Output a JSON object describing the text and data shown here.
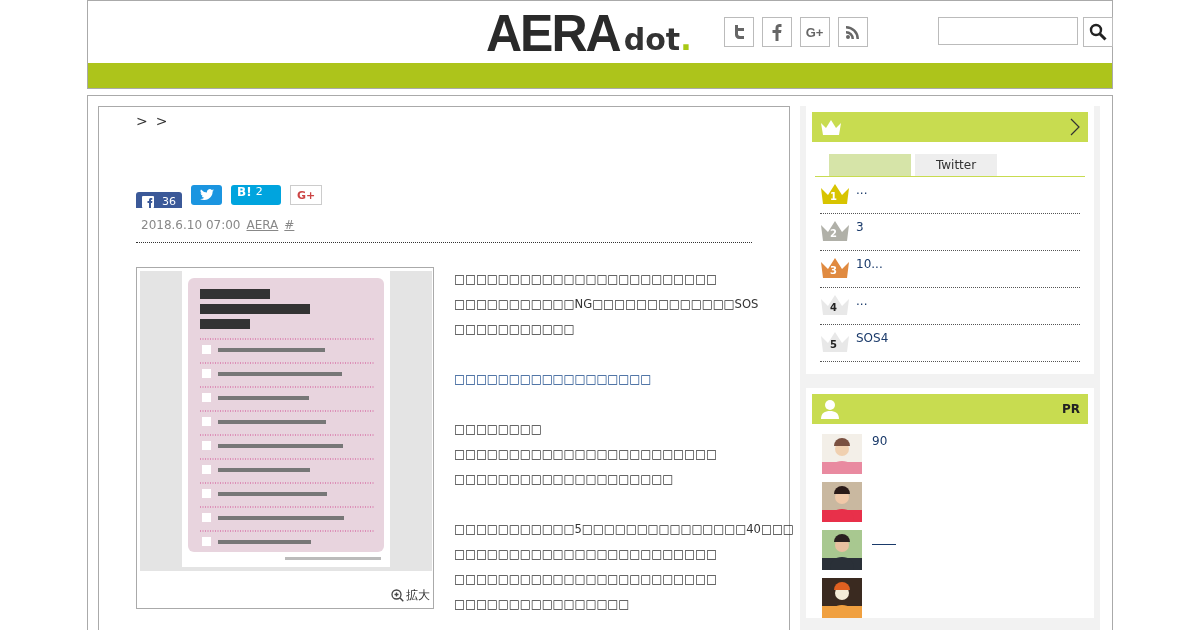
{
  "header": {
    "logo": {
      "word": "AERA",
      "suffix": "dot",
      "dot": "."
    },
    "social": [
      {
        "kind": "twitter"
      },
      {
        "kind": "facebook"
      },
      {
        "kind": "gplus",
        "label": "G+"
      },
      {
        "kind": "rss"
      }
    ]
  },
  "article": {
    "breadcrumb": [
      ">",
      ">"
    ],
    "share": [
      {
        "kind": "facebook",
        "count": "36"
      },
      {
        "kind": "twitter"
      },
      {
        "kind": "hatena",
        "label": "B!",
        "count": "2"
      },
      {
        "kind": "gplus",
        "label": "G+"
      }
    ],
    "meta": {
      "date": "2018.6.10 07:00",
      "source": "AERA",
      "tag": "#"
    },
    "figure": {
      "kind": "picture",
      "caption": "拡大"
    },
    "paragraphs": [
      {
        "kind": "text",
        "lines": [
          "□□□□□□□□□□□□□□□□□□□□□□□□",
          "□□□□□□□□□□□NG□□□□□□□□□□□□□SOS",
          "□□□□□□□□□□□"
        ]
      },
      {
        "kind": "link",
        "lines": [
          "□□□□□□□□□□□□□□□□□□"
        ]
      },
      {
        "kind": "text",
        "lines": [
          "□□□□□□□□",
          "□□□□□□□□□□□□□□□□□□□□□□□□",
          "□□□□□□□□□□□□□□□□□□□□"
        ]
      },
      {
        "kind": "text",
        "lines": [
          "□□□□□□□□□□□5□□□□□□□□□□□□□□□40□□□",
          "□□□□□□□□□□□□□□□□□□□□□□□□",
          "□□□□□□□□□□□□□□□□□□□□□□□□",
          "□□□□□□□□□□□□□□□□"
        ]
      }
    ]
  },
  "ranking": {
    "tabs": [
      {
        "selected": true
      },
      {
        "label": "Twitter",
        "selected": false
      }
    ],
    "items": [
      {
        "rank": "1",
        "title": "...",
        "color": "#d8c400"
      },
      {
        "rank": "2",
        "title": "3",
        "color": "#b0b0a8"
      },
      {
        "rank": "3",
        "title": "10...",
        "color": "#e08a40"
      },
      {
        "rank": "4",
        "title": "...",
        "color": "#e8e8e8"
      },
      {
        "rank": "5",
        "title": "SOS4",
        "color": "#e8e8e8"
      }
    ]
  },
  "pr": {
    "label": "PR",
    "items": [
      {
        "title": "90",
        "underline": false
      },
      {
        "underline": false
      },
      {
        "underline": true
      },
      {
        "underline": false
      }
    ]
  }
}
